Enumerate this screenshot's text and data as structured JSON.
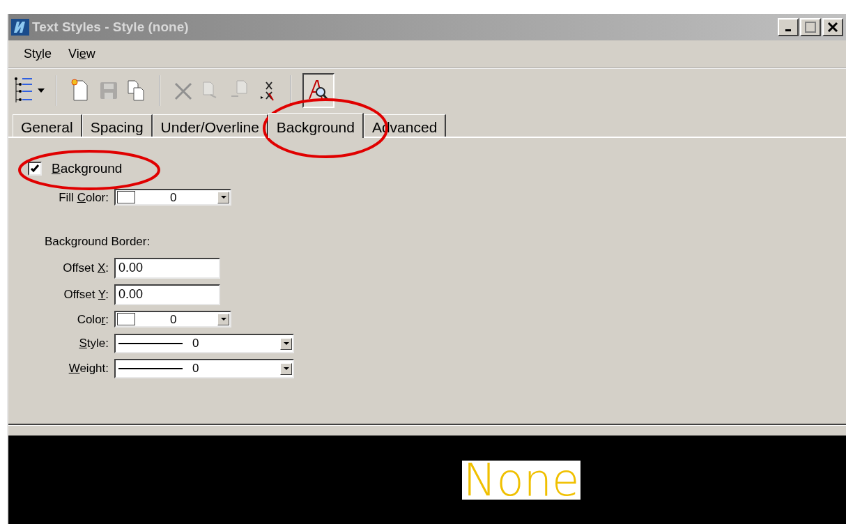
{
  "window": {
    "title": "Text Styles - Style (none)"
  },
  "menu": [
    {
      "label": {
        "before": "St",
        "key": "y",
        "after": "le"
      }
    },
    {
      "label": {
        "before": "Vi",
        "key": "e",
        "after": "w"
      }
    }
  ],
  "tabs": [
    {
      "label": "General",
      "selected": false
    },
    {
      "label": "Spacing",
      "selected": false
    },
    {
      "label": "Under/Overline",
      "selected": false
    },
    {
      "label": "Background",
      "selected": true
    },
    {
      "label": "Advanced",
      "selected": false
    }
  ],
  "background_checkbox": {
    "label": {
      "key": "B",
      "after": "ackground"
    },
    "checked": true
  },
  "fill_color": {
    "label": {
      "before": "Fill ",
      "key": "C",
      "after": "olor:"
    },
    "value": "0"
  },
  "border_section": {
    "title": "Background Border:",
    "offset_x": {
      "label": {
        "before": "Offset ",
        "key": "X",
        "after": ":"
      },
      "value": "0.00"
    },
    "offset_y": {
      "label": {
        "before": "Offset ",
        "key": "Y",
        "after": ":"
      },
      "value": "0.00"
    },
    "color": {
      "label": {
        "before": "Colo",
        "key": "r",
        "after": ":"
      },
      "value": "0"
    },
    "style": {
      "label": {
        "key": "S",
        "after": "tyle:"
      },
      "value": "0"
    },
    "weight": {
      "label": {
        "key": "W",
        "after": "eight:"
      },
      "value": "0"
    }
  },
  "preview": {
    "text": "None"
  }
}
